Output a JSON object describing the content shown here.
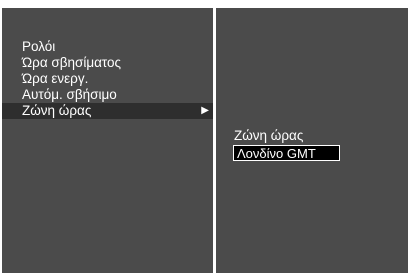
{
  "menu": {
    "items": [
      {
        "label": "Ρολόι"
      },
      {
        "label": "Ώρα σβησίματος"
      },
      {
        "label": "Ώρα ενεργ."
      },
      {
        "label": "Αυτόμ. σβήσιμο"
      },
      {
        "label": "Ζώνη ώρας",
        "selected": true,
        "arrow": "▶"
      }
    ]
  },
  "submenu": {
    "title": "Ζώνη ώρας",
    "value": "Λονδίνο GMT"
  }
}
